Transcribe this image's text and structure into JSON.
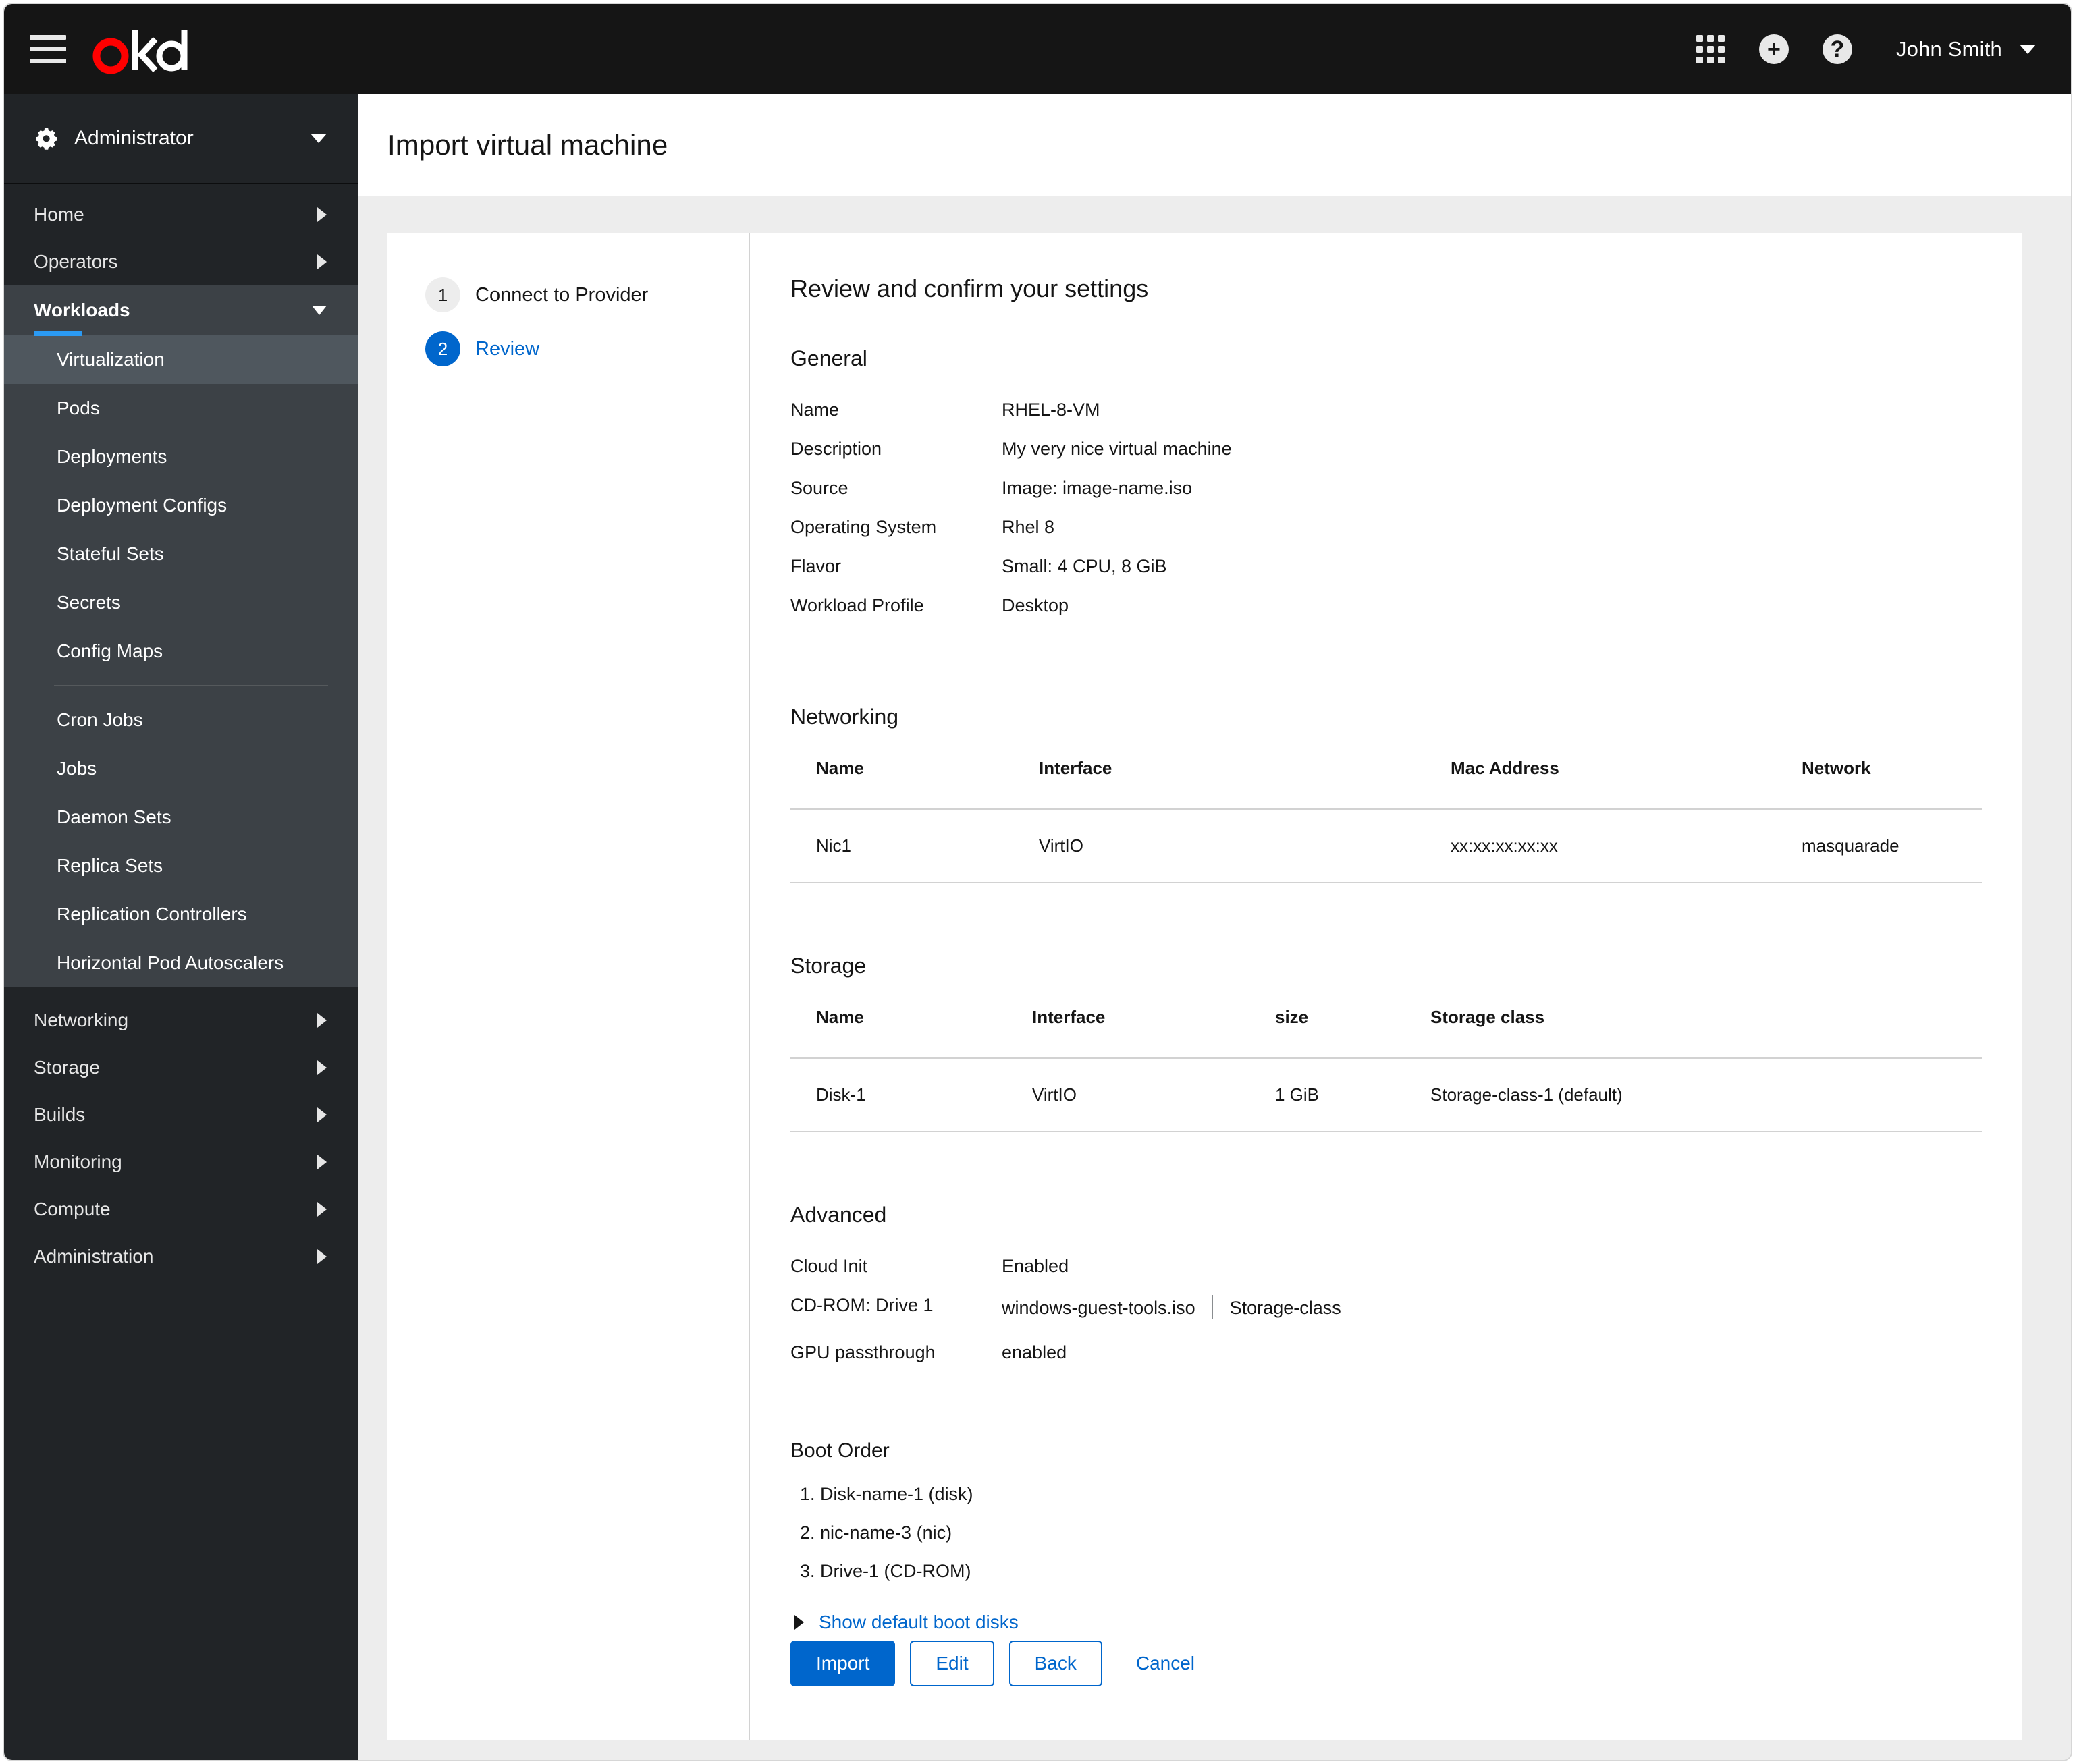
{
  "masthead": {
    "brand": "okd",
    "hamburger_label": "Global navigation",
    "apps_icon": "grid-icon",
    "add_icon": "plus-circle-icon",
    "help_icon": "question-circle-icon",
    "user_name": "John Smith"
  },
  "sidebar": {
    "perspective": "Administrator",
    "top_items": [
      {
        "label": "Home",
        "chevron": "right"
      },
      {
        "label": "Operators",
        "chevron": "right"
      }
    ],
    "section": {
      "label": "Workloads",
      "chevron": "down",
      "group_a": [
        {
          "label": "Virtualization",
          "active": true
        },
        {
          "label": "Pods",
          "active": false
        },
        {
          "label": "Deployments",
          "active": false
        },
        {
          "label": "Deployment Configs",
          "active": false
        },
        {
          "label": "Stateful Sets",
          "active": false
        },
        {
          "label": "Secrets",
          "active": false
        },
        {
          "label": "Config Maps",
          "active": false
        }
      ],
      "group_b": [
        {
          "label": "Cron Jobs",
          "active": false
        },
        {
          "label": "Jobs",
          "active": false
        },
        {
          "label": "Daemon Sets",
          "active": false
        },
        {
          "label": "Replica Sets",
          "active": false
        },
        {
          "label": "Replication Controllers",
          "active": false
        },
        {
          "label": "Horizontal Pod Autoscalers",
          "active": false
        }
      ]
    },
    "bottom_items": [
      {
        "label": "Networking",
        "chevron": "right"
      },
      {
        "label": "Storage",
        "chevron": "right"
      },
      {
        "label": "Builds",
        "chevron": "right"
      },
      {
        "label": "Monitoring",
        "chevron": "right"
      },
      {
        "label": "Compute",
        "chevron": "right"
      },
      {
        "label": "Administration",
        "chevron": "right"
      }
    ]
  },
  "page": {
    "title": "Import virtual machine"
  },
  "wizard": {
    "steps": [
      {
        "number": "1",
        "label": "Connect to Provider",
        "active": false
      },
      {
        "number": "2",
        "label": "Review",
        "active": true
      }
    ],
    "heading": "Review and confirm your settings",
    "general": {
      "title": "General",
      "rows": [
        {
          "term": "Name",
          "desc": "RHEL-8-VM"
        },
        {
          "term": "Description",
          "desc": "My very nice virtual machine"
        },
        {
          "term": "Source",
          "desc": "Image: image-name.iso"
        },
        {
          "term": "Operating System",
          "desc": "Rhel 8"
        },
        {
          "term": "Flavor",
          "desc": "Small: 4 CPU, 8 GiB"
        },
        {
          "term": "Workload Profile",
          "desc": "Desktop"
        }
      ]
    },
    "networking": {
      "title": "Networking",
      "columns": [
        "Name",
        "Interface",
        "Mac Address",
        "Network"
      ],
      "rows": [
        [
          "Nic1",
          "VirtIO",
          "xx:xx:xx:xx:xx",
          "masquarade"
        ]
      ]
    },
    "storage": {
      "title": "Storage",
      "columns": [
        "Name",
        "Interface",
        "size",
        "Storage class"
      ],
      "rows": [
        [
          "Disk-1",
          "VirtIO",
          "1 GiB",
          "Storage-class-1 (default)"
        ]
      ]
    },
    "advanced": {
      "title": "Advanced",
      "rows": [
        {
          "term": "Cloud Init",
          "desc": "Enabled"
        },
        {
          "term": "CD-ROM: Drive 1",
          "desc": "windows-guest-tools.iso",
          "desc2": "Storage-class"
        },
        {
          "term": "GPU passthrough",
          "desc": "enabled"
        }
      ]
    },
    "boot_order": {
      "title": "Boot Order",
      "items": [
        "1. Disk-name-1 (disk)",
        "2. nic-name-3 (nic)",
        "3. Drive-1 (CD-ROM)"
      ],
      "show_default_link": "Show default boot disks"
    },
    "actions": {
      "import": "Import",
      "edit": "Edit",
      "back": "Back",
      "cancel": "Cancel"
    }
  },
  "colors": {
    "brand_red": "#ff0000",
    "accent_blue": "#0066cc",
    "active_indicator": "#2b9af3",
    "masthead_bg": "#151515",
    "sidebar_bg": "#212427"
  }
}
